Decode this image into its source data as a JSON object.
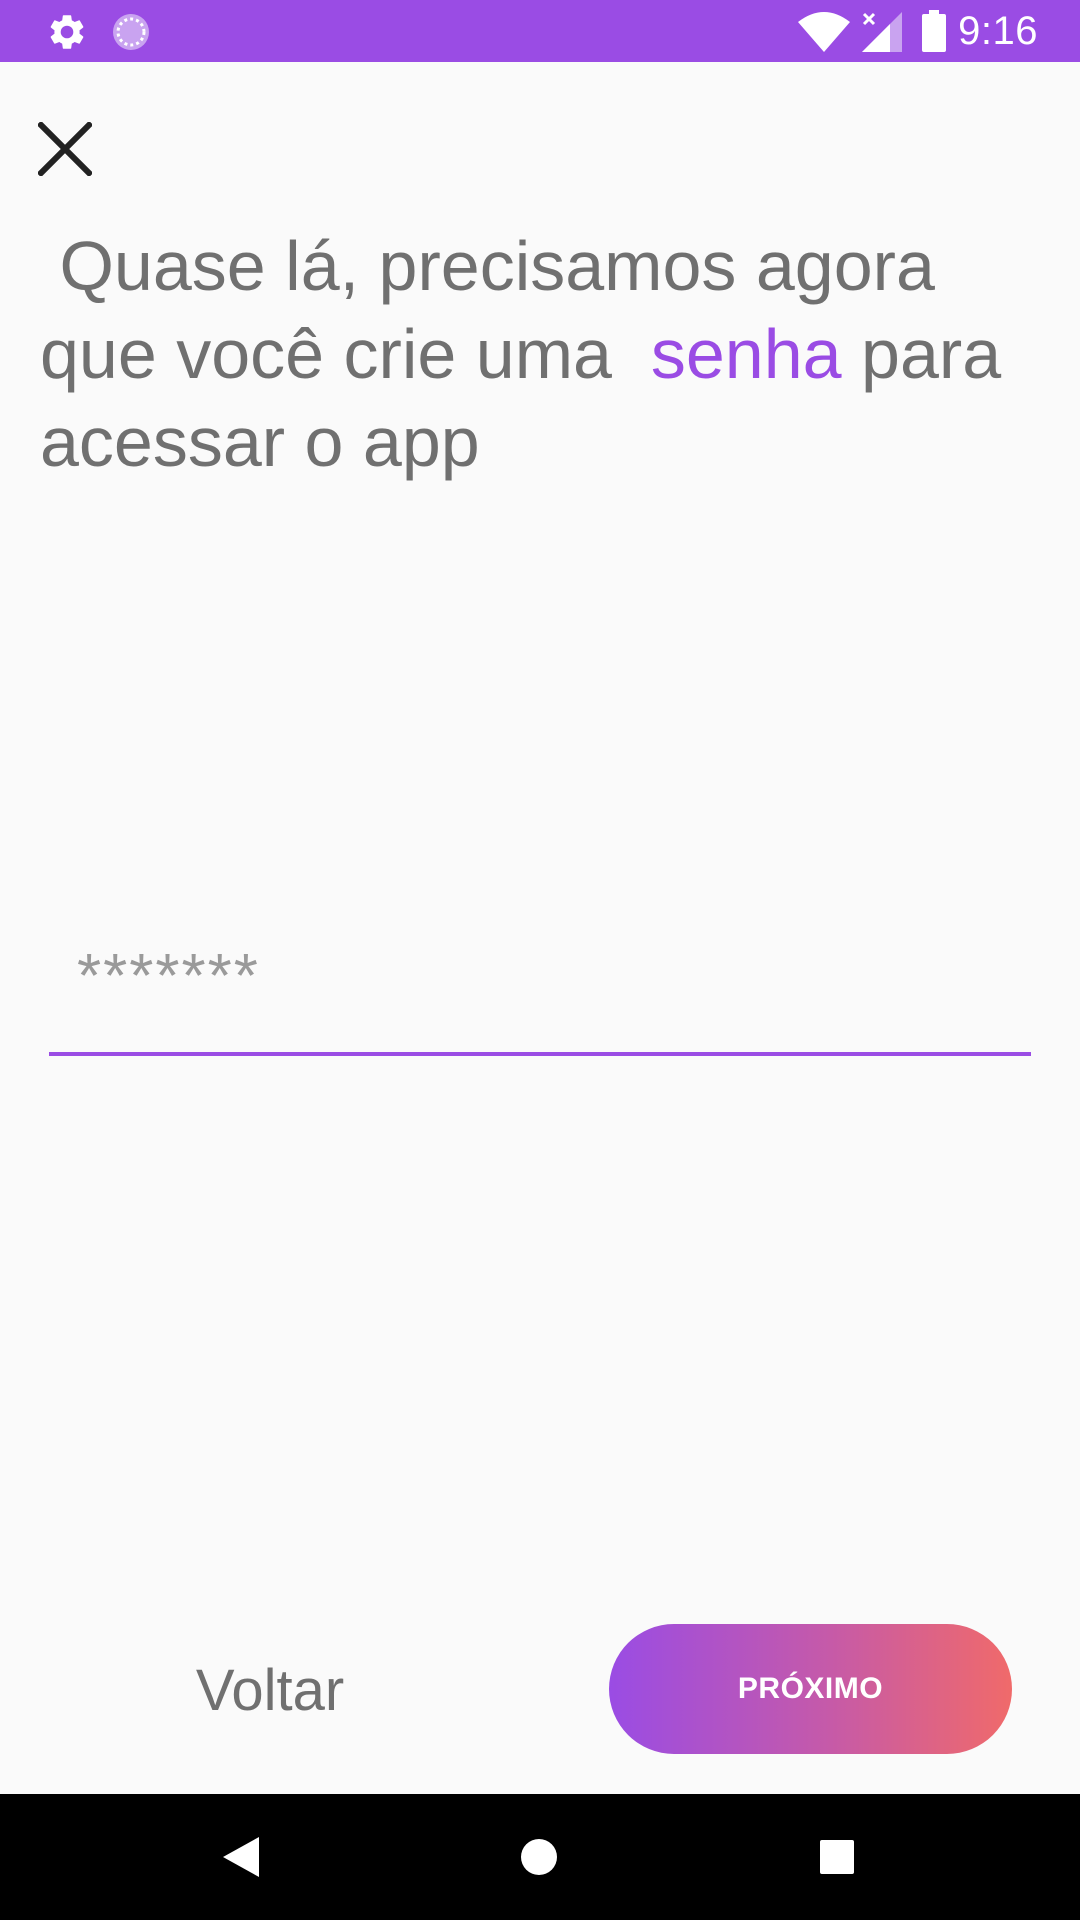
{
  "status_bar": {
    "time": "9:16",
    "background": "#9a4ce4",
    "icons": [
      "gear-icon",
      "sync-icon",
      "wifi-icon",
      "signal-icon",
      "battery-icon"
    ]
  },
  "close": {
    "icon": "close-icon"
  },
  "heading": {
    "before": " Quase lá, precisamos agora que você crie uma  ",
    "accent": "senha",
    "after": " para acessar o app",
    "accent_color": "#9a4ce4",
    "text_color": "#707070"
  },
  "password": {
    "value": "",
    "placeholder": "*******"
  },
  "buttons": {
    "back_label": "Voltar",
    "next_label": "PRÓXIMO",
    "gradient_start": "#9a4ce4",
    "gradient_end": "#f06a6a"
  },
  "nav_bar": {
    "icons": [
      "back-triangle-icon",
      "home-circle-icon",
      "recents-square-icon"
    ]
  }
}
